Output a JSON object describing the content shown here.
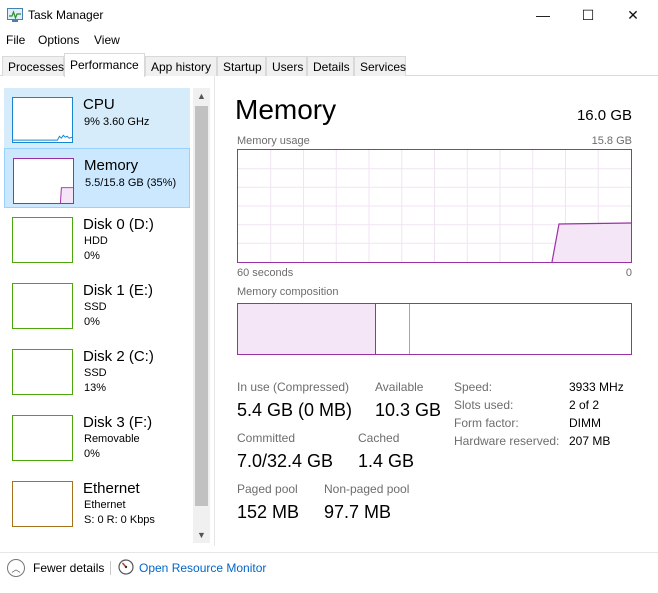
{
  "window": {
    "title": "Task Manager",
    "minimize": "—",
    "maximize": "☐",
    "close": "✕"
  },
  "menu": [
    "File",
    "Options",
    "View"
  ],
  "tabs": [
    "Processes",
    "Performance",
    "App history",
    "Startup",
    "Users",
    "Details",
    "Services"
  ],
  "active_tab": "Performance",
  "sidebar": {
    "items": [
      {
        "name": "CPU",
        "sub1": "9%  3.60 GHz",
        "sub2": "",
        "color": "#1785d1"
      },
      {
        "name": "Memory",
        "sub1": "5.5/15.8 GB (35%)",
        "sub2": "",
        "color": "#9b30a5"
      },
      {
        "name": "Disk 0 (D:)",
        "sub1": "HDD",
        "sub2": "0%",
        "color": "#4da60c"
      },
      {
        "name": "Disk 1 (E:)",
        "sub1": "SSD",
        "sub2": "0%",
        "color": "#4da60c"
      },
      {
        "name": "Disk 2 (C:)",
        "sub1": "SSD",
        "sub2": "13%",
        "color": "#4da60c"
      },
      {
        "name": "Disk 3 (F:)",
        "sub1": "Removable",
        "sub2": "0%",
        "color": "#4da60c"
      },
      {
        "name": "Ethernet",
        "sub1": "Ethernet",
        "sub2": "S: 0  R: 0 Kbps",
        "color": "#a7701a"
      }
    ]
  },
  "main": {
    "title": "Memory",
    "total": "16.0 GB",
    "usage_label": "Memory usage",
    "usage_max": "15.8 GB",
    "time_left": "60 seconds",
    "time_right": "0",
    "composition_label": "Memory composition",
    "stats": {
      "in_use_label": "In use (Compressed)",
      "in_use_value": "5.4 GB (0 MB)",
      "available_label": "Available",
      "available_value": "10.3 GB",
      "committed_label": "Committed",
      "committed_value": "7.0/32.4 GB",
      "cached_label": "Cached",
      "cached_value": "1.4 GB",
      "paged_label": "Paged pool",
      "paged_value": "152 MB",
      "nonpaged_label": "Non-paged pool",
      "nonpaged_value": "97.7 MB"
    },
    "specs": [
      {
        "label": "Speed:",
        "value": "3933 MHz"
      },
      {
        "label": "Slots used:",
        "value": "2 of 2"
      },
      {
        "label": "Form factor:",
        "value": "DIMM"
      },
      {
        "label": "Hardware reserved:",
        "value": "207 MB"
      }
    ]
  },
  "footer": {
    "fewer_details": "Fewer details",
    "resource_monitor": "Open Resource Monitor"
  },
  "colors": {
    "memory": "#9b30a5",
    "cpu": "#1785d1",
    "disk": "#4da60c",
    "ethernet": "#a7701a",
    "link": "#0066cc"
  }
}
